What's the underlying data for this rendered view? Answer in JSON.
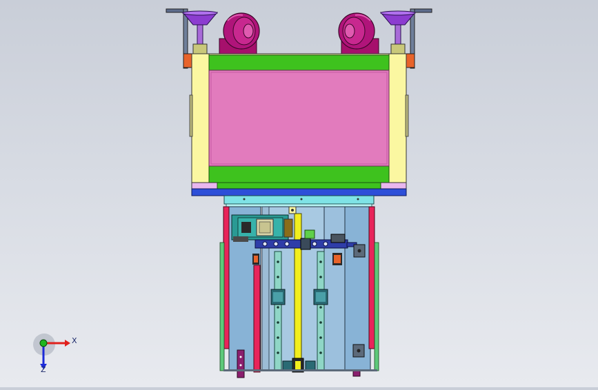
{
  "viewport": {
    "background_top": "#c9ced8",
    "background_bottom": "#e8eaef"
  },
  "triad": {
    "x_label": "X",
    "z_label": "Z",
    "x_color": "#e0201c",
    "y_color": "#1fb51f",
    "z_color": "#1c2ad8"
  },
  "palette": {
    "frame_yellow": "#fbf7a1",
    "top_green": "#3ec21e",
    "panel_pink": "#e27bbd",
    "base_blue": "#2d4fd8",
    "plate_cyan": "#7fe3e6",
    "body_blue": "#88b3d6",
    "rail_teal": "#8fd6c6",
    "strip_red": "#e8245a",
    "strip_green": "#5ec97a",
    "caster_magenta": "#b0147a",
    "foot_purple": "#8c3cd0",
    "motor_teal": "#2a9a94",
    "center_yellow": "#f2ee1e",
    "crossbar_navy": "#2e3da8",
    "bracket_gray": "#5c6a7a"
  }
}
